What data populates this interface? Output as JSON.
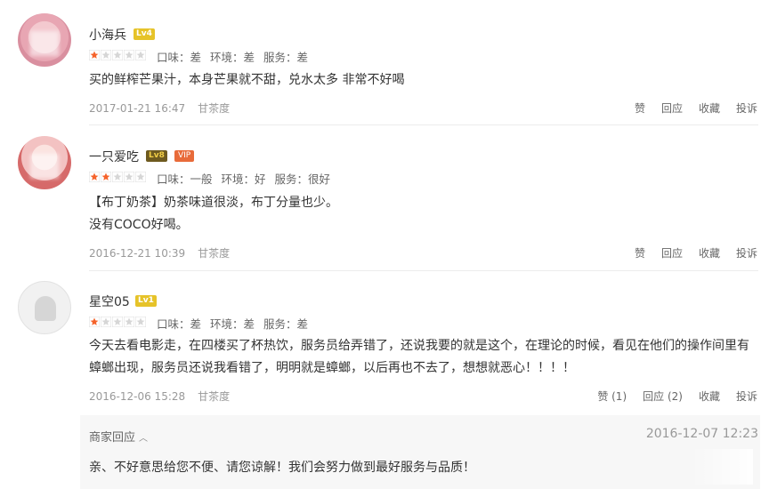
{
  "reviews": [
    {
      "username": "小海兵",
      "level": "Lv4",
      "stars": 1,
      "scores": [
        "口味：差",
        "环境：差",
        "服务：差"
      ],
      "text": "买的鲜榨芒果汁，本身芒果就不甜，兑水太多 非常不好喝",
      "time": "2017-01-21 16:47",
      "shop": "甘茶度",
      "actions": [
        "赞",
        "回应",
        "收藏",
        "投诉"
      ]
    },
    {
      "username": "一只爱吃",
      "level": "Lv8",
      "vip": "VIP",
      "stars": 2,
      "scores": [
        "口味：一般",
        "环境：好",
        "服务：很好"
      ],
      "text": "【布丁奶茶】奶茶味道很淡，布丁分量也少。",
      "text2": "没有COCO好喝。",
      "time": "2016-12-21 10:39",
      "shop": "甘茶度",
      "actions": [
        "赞",
        "回应",
        "收藏",
        "投诉"
      ]
    },
    {
      "username": "星空05",
      "level": "Lv1",
      "stars": 1,
      "scores": [
        "口味：差",
        "环境：差",
        "服务：差"
      ],
      "text": "今天去看电影走，在四楼买了杯热饮，服务员给弄错了，还说我要的就是这个，在理论的时候，看见在他们的操作间里有",
      "text2": "蟑螂出现，服务员还说我看错了，明明就是蟑螂，以后再也不去了，想想就恶心！！！！",
      "time": "2016-12-06 15:28",
      "shop": "甘茶度",
      "actions": [
        "赞 (1)",
        "回应 (2)",
        "收藏",
        "投诉"
      ]
    }
  ],
  "merchant_reply": {
    "label": "商家回应",
    "time": "2016-12-07 12:23",
    "text": "亲、不好意思给您不便、请您谅解！我们会努力做到最好服务与品质！"
  },
  "colors": {
    "star_on": "#f5622a",
    "star_off": "#d6d6d6",
    "level_badge": "#e6c329",
    "vip_badge": "#e86b3a"
  }
}
